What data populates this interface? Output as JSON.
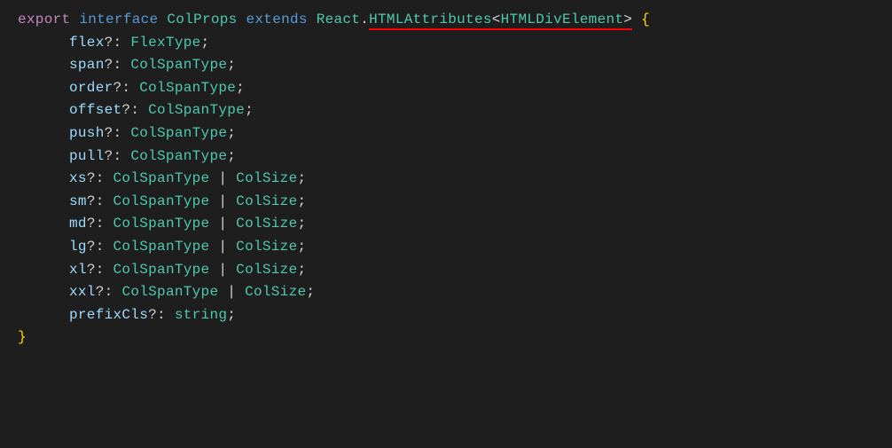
{
  "code": {
    "export": "export",
    "interface": "interface",
    "interfaceName": "ColProps",
    "extends": "extends",
    "namespace": "React",
    "dot": ".",
    "baseType": "HTMLAttributes",
    "genericOpen": "<",
    "genericType": "HTMLDivElement",
    "genericClose": ">",
    "openBrace": "{",
    "closeBrace": "}",
    "props": [
      {
        "name": "flex",
        "optional": "?:",
        "type1": "FlexType",
        "union": false
      },
      {
        "name": "span",
        "optional": "?:",
        "type1": "ColSpanType",
        "union": false
      },
      {
        "name": "order",
        "optional": "?:",
        "type1": "ColSpanType",
        "union": false
      },
      {
        "name": "offset",
        "optional": "?:",
        "type1": "ColSpanType",
        "union": false
      },
      {
        "name": "push",
        "optional": "?:",
        "type1": "ColSpanType",
        "union": false
      },
      {
        "name": "pull",
        "optional": "?:",
        "type1": "ColSpanType",
        "union": false
      },
      {
        "name": "xs",
        "optional": "?:",
        "type1": "ColSpanType",
        "union": true,
        "type2": "ColSize"
      },
      {
        "name": "sm",
        "optional": "?:",
        "type1": "ColSpanType",
        "union": true,
        "type2": "ColSize"
      },
      {
        "name": "md",
        "optional": "?:",
        "type1": "ColSpanType",
        "union": true,
        "type2": "ColSize"
      },
      {
        "name": "lg",
        "optional": "?:",
        "type1": "ColSpanType",
        "union": true,
        "type2": "ColSize"
      },
      {
        "name": "xl",
        "optional": "?:",
        "type1": "ColSpanType",
        "union": true,
        "type2": "ColSize"
      },
      {
        "name": "xxl",
        "optional": "?:",
        "type1": "ColSpanType",
        "union": true,
        "type2": "ColSize"
      },
      {
        "name": "prefixCls",
        "optional": "?:",
        "type1": "string",
        "union": false,
        "primitive": true
      }
    ],
    "pipe": " | ",
    "semicolon": ";"
  }
}
